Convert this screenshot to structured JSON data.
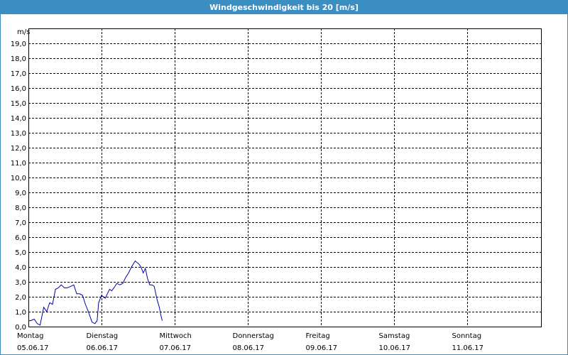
{
  "window": {
    "title": "Windgeschwindigkeit bis 20 [m/s]"
  },
  "colors": {
    "title_bar": "#3b8ec2",
    "grid": "#000000",
    "series": "#0000aa"
  },
  "chart_data": {
    "type": "line",
    "title": "Windgeschwindigkeit bis 20 [m/s]",
    "ylabel": "m/s",
    "xlabel": "",
    "ylim": [
      0,
      20
    ],
    "xlim": [
      0,
      7
    ],
    "grid": true,
    "y_ticks": [
      "0,0",
      "1,0",
      "2,0",
      "3,0",
      "4,0",
      "5,0",
      "6,0",
      "7,0",
      "8,0",
      "9,0",
      "10,0",
      "11,0",
      "12,0",
      "13,0",
      "14,0",
      "15,0",
      "16,0",
      "17,0",
      "18,0",
      "19,0"
    ],
    "days": [
      {
        "day": "Montag",
        "date": "05.06.17"
      },
      {
        "day": "Dienstag",
        "date": "06.06.17"
      },
      {
        "day": "Mittwoch",
        "date": "07.06.17"
      },
      {
        "day": "Donnerstag",
        "date": "08.06.17"
      },
      {
        "day": "Freitag",
        "date": "09.06.17"
      },
      {
        "day": "Samstag",
        "date": "10.06.17"
      },
      {
        "day": "Sonntag",
        "date": "11.06.17"
      }
    ],
    "series": [
      {
        "x": [
          0.0,
          0.03,
          0.08,
          0.12,
          0.16,
          0.21,
          0.25,
          0.29,
          0.33,
          0.37,
          0.41,
          0.45,
          0.49,
          0.53,
          0.58,
          0.62,
          0.66,
          0.7,
          0.74,
          0.78,
          0.82,
          0.87,
          0.91,
          0.94,
          0.96,
          1.0,
          1.05,
          1.08,
          1.11,
          1.14,
          1.17,
          1.21,
          1.25,
          1.29,
          1.33,
          1.37,
          1.41,
          1.46,
          1.51,
          1.54,
          1.57,
          1.6,
          1.63,
          1.66,
          1.69,
          1.72,
          1.76,
          1.79,
          1.81,
          1.83
        ],
        "values": [
          0.4,
          0.4,
          0.5,
          0.2,
          0.1,
          1.3,
          1.0,
          1.6,
          1.5,
          2.5,
          2.6,
          2.8,
          2.6,
          2.6,
          2.7,
          2.8,
          2.2,
          2.2,
          2.1,
          1.5,
          1.0,
          0.3,
          0.2,
          0.4,
          1.6,
          2.1,
          1.9,
          2.2,
          2.5,
          2.4,
          2.6,
          2.9,
          2.8,
          2.9,
          3.3,
          3.6,
          4.0,
          4.4,
          4.2,
          4.0,
          3.6,
          3.9,
          3.2,
          2.8,
          2.8,
          2.7,
          1.8,
          1.3,
          0.8,
          0.4
        ]
      }
    ]
  }
}
